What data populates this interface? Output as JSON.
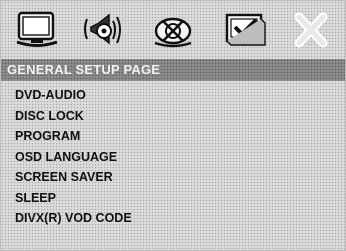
{
  "toolbar": {
    "icons": [
      {
        "name": "general-setup-icon",
        "selected": true
      },
      {
        "name": "audio-setup-icon"
      },
      {
        "name": "video-setup-icon"
      },
      {
        "name": "preference-setup-icon"
      },
      {
        "name": "exit-icon"
      }
    ]
  },
  "page": {
    "title": "GENERAL SETUP PAGE"
  },
  "menu": {
    "items": [
      {
        "label": "DVD-AUDIO"
      },
      {
        "label": "DISC LOCK"
      },
      {
        "label": "PROGRAM"
      },
      {
        "label": "OSD LANGUAGE"
      },
      {
        "label": "SCREEN SAVER"
      },
      {
        "label": "SLEEP"
      },
      {
        "label": "DIVX(R) VOD CODE"
      }
    ]
  },
  "colors": {
    "background": "#dcdcdc",
    "selected_bar": "#8c8c8c",
    "selected_text": "#f2f2f2",
    "item_text": "#111111"
  }
}
